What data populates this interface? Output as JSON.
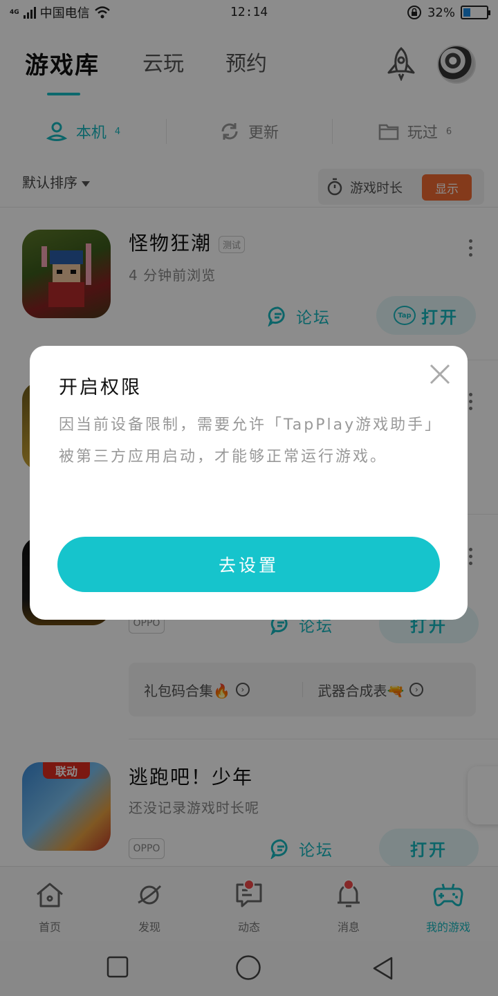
{
  "status_bar": {
    "carrier": "中国电信",
    "network": "4G",
    "time": "12:14",
    "battery": "32%",
    "battery_level": 0.32
  },
  "header": {
    "tabs": [
      {
        "label": "游戏库",
        "active": true
      },
      {
        "label": "云玩"
      },
      {
        "label": "预约"
      }
    ],
    "rocket_icon": "rocket-icon",
    "avatar_icon": "avatar"
  },
  "subtabs": [
    {
      "label": "本机",
      "count": "4",
      "icon": "user-location-icon",
      "active": true
    },
    {
      "label": "更新",
      "count": "",
      "icon": "refresh-icon"
    },
    {
      "label": "玩过",
      "count": "6",
      "icon": "folder-icon"
    }
  ],
  "sort": {
    "label": "默认排序",
    "playtime_label": "游戏时长",
    "show_button": "显示"
  },
  "games": [
    {
      "title": "怪物狂潮",
      "tag": "测试",
      "subtitle": "4 分钟前浏览",
      "forum": "论坛",
      "open": "打开",
      "open_badge": "Tap"
    },
    {
      "oppo_tag": "OPPO",
      "forum": "论坛",
      "open": "打开",
      "gift_left": "礼包码合集🔥",
      "gift_right": "武器合成表🔫"
    },
    {
      "title": "逃跑吧！少年",
      "badge": "联动",
      "subtitle": "还没记录游戏时长呢",
      "oppo_tag": "OPPO",
      "forum": "论坛",
      "open": "打开"
    }
  ],
  "bottom_nav": [
    {
      "label": "首页",
      "icon": "home-icon"
    },
    {
      "label": "发现",
      "icon": "planet-icon"
    },
    {
      "label": "动态",
      "icon": "chat-icon",
      "dot": true
    },
    {
      "label": "消息",
      "icon": "bell-icon",
      "dot": true
    },
    {
      "label": "我的游戏",
      "icon": "gamepad-icon",
      "active": true
    }
  ],
  "dialog": {
    "title": "开启权限",
    "body": "因当前设备限制，需要允许「TapPlay游戏助手」被第三方应用启动，才能够正常运行游戏。",
    "button": "去设置"
  },
  "colors": {
    "accent": "#16c4cc",
    "show_button": "#f06a32",
    "red_dot": "#f24a4a"
  }
}
